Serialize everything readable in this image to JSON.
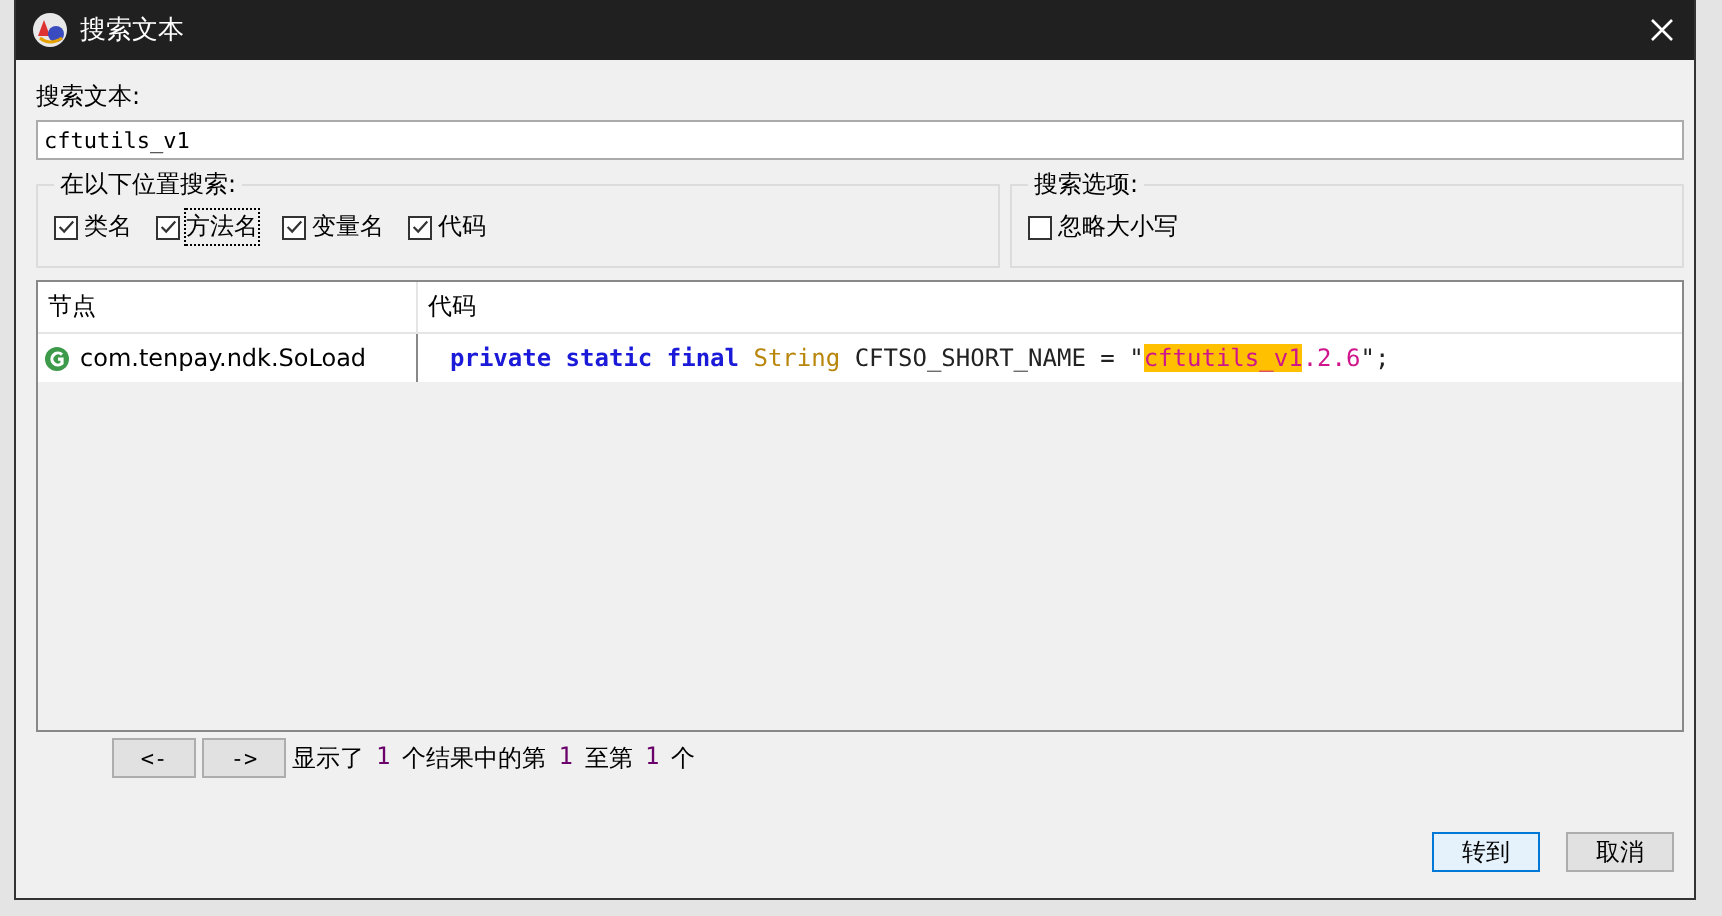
{
  "window": {
    "title": "搜索文本"
  },
  "search": {
    "label": "搜索文本:",
    "value": "cftutils_v1"
  },
  "location_group": {
    "title": "在以下位置搜索:",
    "options": [
      {
        "label": "类名",
        "checked": true,
        "focused": false
      },
      {
        "label": "方法名",
        "checked": true,
        "focused": true
      },
      {
        "label": "变量名",
        "checked": true,
        "focused": false
      },
      {
        "label": "代码",
        "checked": true,
        "focused": false
      }
    ]
  },
  "options_group": {
    "title": "搜索选项:",
    "options": [
      {
        "label": "忽略大小写",
        "checked": false,
        "focused": false
      }
    ]
  },
  "table": {
    "columns": [
      "节点",
      "代码"
    ],
    "rows": [
      {
        "node": "com.tenpay.ndk.SoLoad",
        "code": [
          {
            "kind": "keyword",
            "text": "private static final"
          },
          {
            "kind": "type",
            "text": "String"
          },
          {
            "kind": "plain",
            "text": "CFTSO_SHORT_NAME = \""
          },
          {
            "kind": "match",
            "text": "cftutils_v1"
          },
          {
            "kind": "string",
            "text": ".2.6"
          },
          {
            "kind": "plain",
            "text": "\";"
          }
        ]
      }
    ]
  },
  "nav_buttons": [
    "<-",
    "->"
  ],
  "status": [
    {
      "kind": "text",
      "text": "显示了"
    },
    {
      "kind": "number",
      "text": "1"
    },
    {
      "kind": "text",
      "text": "个结果中的第"
    },
    {
      "kind": "number",
      "text": "1"
    },
    {
      "kind": "text",
      "text": "至第"
    },
    {
      "kind": "number",
      "text": "1"
    },
    {
      "kind": "text",
      "text": "个"
    }
  ],
  "buttons": [
    {
      "label": "转到",
      "default": true
    },
    {
      "label": "取消",
      "default": false
    }
  ]
}
